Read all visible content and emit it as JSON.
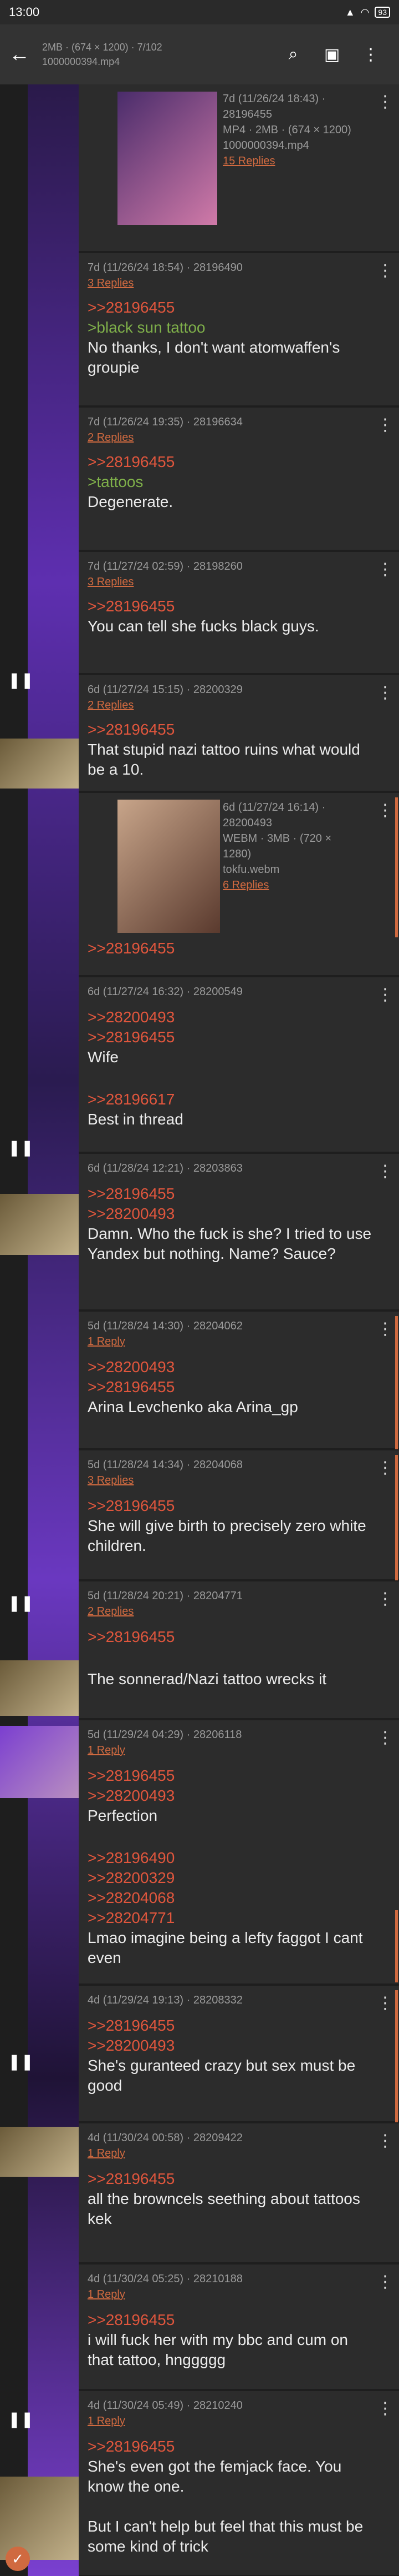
{
  "status": {
    "time": "13:00",
    "battery": "93"
  },
  "toolbar": {
    "title_line1": "2MB · (674 × 1200) · 7/102",
    "title_line2": "1000000394.mp4"
  },
  "posts": [
    {
      "meta1": "7d (11/26/24 18:43) ·",
      "meta2": "28196455",
      "meta3": "MP4 · 2MB · (674 × 1200)",
      "meta4": "1000000394.mp4",
      "replies": "15 Replies"
    },
    {
      "meta": "7d (11/26/24 18:54) · 28196490",
      "replies": "3 Replies",
      "q1": ">>28196455",
      "green": ">black sun tattoo",
      "body": "No thanks, I don't want atomwaffen's groupie"
    },
    {
      "meta": "7d (11/26/24 19:35) · 28196634",
      "replies": "2 Replies",
      "q1": ">>28196455",
      "green": ">tattoos",
      "body": "Degenerate."
    },
    {
      "meta": "7d (11/27/24 02:59) · 28198260",
      "replies": "3 Replies",
      "q1": ">>28196455",
      "body": "You can tell she fucks black guys."
    },
    {
      "meta": "6d (11/27/24 15:15) · 28200329",
      "replies": "2 Replies",
      "q1": ">>28196455",
      "body": "That stupid nazi tattoo ruins what would be a 10."
    },
    {
      "meta1": "6d (11/27/24 16:14) ·",
      "meta2": "28200493",
      "meta3": "WEBM · 3MB · (720 ×",
      "meta4": "1280)",
      "meta5": "tokfu.webm",
      "replies": "6 Replies",
      "q1": ">>28196455"
    },
    {
      "meta": "6d (11/27/24 16:32) · 28200549",
      "q1": ">>28200493",
      "q2": ">>28196455",
      "body": "Wife",
      "q3": ">>28196617",
      "body2": "Best in thread"
    },
    {
      "meta": "6d (11/28/24 12:21) · 28203863",
      "q1": ">>28196455",
      "q2": ">>28200493",
      "body": "Damn. Who the fuck is she? I tried to use Yandex but nothing. Name? Sauce?"
    },
    {
      "meta": "5d (11/28/24 14:30) · 28204062",
      "replies": "1 Reply",
      "q1": ">>28200493",
      "q2": ">>28196455",
      "body": "Arina Levchenko aka Arina_gp"
    },
    {
      "meta": "5d (11/28/24 14:34) · 28204068",
      "replies": "3 Replies",
      "q1": ">>28196455",
      "body": "She will give birth to precisely zero white children."
    },
    {
      "meta": "5d (11/28/24 20:21) · 28204771",
      "replies": "2 Replies",
      "q1": ">>28196455",
      "body": "The sonnerad/Nazi tattoo wrecks it"
    },
    {
      "meta": "5d (11/29/24 04:29) · 28206118",
      "replies": "1 Reply",
      "q1": ">>28196455",
      "q2": ">>28200493",
      "body": "Perfection",
      "q3": ">>28196490",
      "q4": ">>28200329",
      "q5": ">>28204068",
      "q6": ">>28204771",
      "body2": "Lmao imagine being a lefty faggot I cant even"
    },
    {
      "meta": "4d (11/29/24 19:13) · 28208332",
      "q1": ">>28196455",
      "q2": ">>28200493",
      "body": "She's guranteed crazy but sex must be good"
    },
    {
      "meta": "4d (11/30/24 00:58) · 28209422",
      "replies": "1 Reply",
      "q1": ">>28196455",
      "body": "all the browncels seething about tattoos kek"
    },
    {
      "meta": "4d (11/30/24 05:25) · 28210188",
      "replies": "1 Reply",
      "q1": ">>28196455",
      "body": "i will fuck her with my bbc and cum on that tattoo, hnggggg"
    },
    {
      "meta": "4d (11/30/24 05:49) · 28210240",
      "replies": "1 Reply",
      "q1": ">>28196455",
      "body": "She's even got the femjack face. You know the one.",
      "body2": "But I can't help but feel that this must be some kind of trick"
    }
  ]
}
